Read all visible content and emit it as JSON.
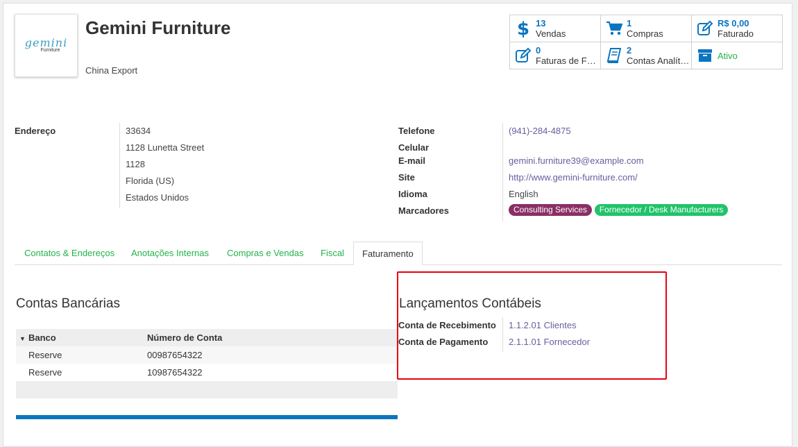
{
  "partner": {
    "name": "Gemini Furniture",
    "company": "China Export",
    "logo_main": "gemini",
    "logo_sub": "Furniture"
  },
  "smart_buttons": [
    {
      "value": "13",
      "label": "Vendas",
      "icon": "dollar-icon"
    },
    {
      "value": "1",
      "label": "Compras",
      "icon": "cart-icon"
    },
    {
      "value": "R$ 0,00",
      "label": "Faturado",
      "icon": "pencil-square-icon"
    },
    {
      "value": "0",
      "label": "Faturas de Fo…",
      "icon": "pencil-square-icon"
    },
    {
      "value": "2",
      "label": "Contas Analíti…",
      "icon": "book-icon"
    },
    {
      "value": "",
      "label": "Ativo",
      "icon": "archive-icon"
    }
  ],
  "address": {
    "label": "Endereço",
    "lines": [
      "33634",
      "1128 Lunetta Street",
      "1128",
      "Florida (US)",
      "Estados Unidos"
    ]
  },
  "contact": {
    "phone_label": "Telefone",
    "phone": "(941)-284-4875",
    "mobile_label": "Celular",
    "email_label": "E-mail",
    "email": "gemini.furniture39@example.com",
    "site_label": "Site",
    "site": "http://www.gemini-furniture.com/",
    "lang_label": "Idioma",
    "lang": "English",
    "tags_label": "Marcadores",
    "tags": [
      {
        "label": "Consulting Services",
        "color": "#8a2f65"
      },
      {
        "label": "Fornecedor / Desk Manufacturers",
        "color": "#21c36a"
      }
    ]
  },
  "tabs": [
    {
      "label": "Contatos & Endereços"
    },
    {
      "label": "Anotações Internas"
    },
    {
      "label": "Compras e Vendas"
    },
    {
      "label": "Fiscal"
    },
    {
      "label": "Faturamento",
      "active": true
    }
  ],
  "bank": {
    "title": "Contas Bancárias",
    "col_bank": "Banco",
    "col_account": "Número de Conta",
    "rows": [
      {
        "bank": "Reserve",
        "account": "00987654322"
      },
      {
        "bank": "Reserve",
        "account": "10987654322"
      }
    ]
  },
  "accounting": {
    "title": "Lançamentos Contábeis",
    "receivable_label": "Conta de Recebimento",
    "receivable": "1.1.2.01 Clientes",
    "payable_label": "Conta de Pagamento",
    "payable": "2.1.1.01 Fornecedor"
  },
  "colors": {
    "accent_blue": "#0c75c0",
    "green": "#21b34a",
    "link_purple": "#6c5b9e",
    "highlight_red": "#e6000f"
  }
}
